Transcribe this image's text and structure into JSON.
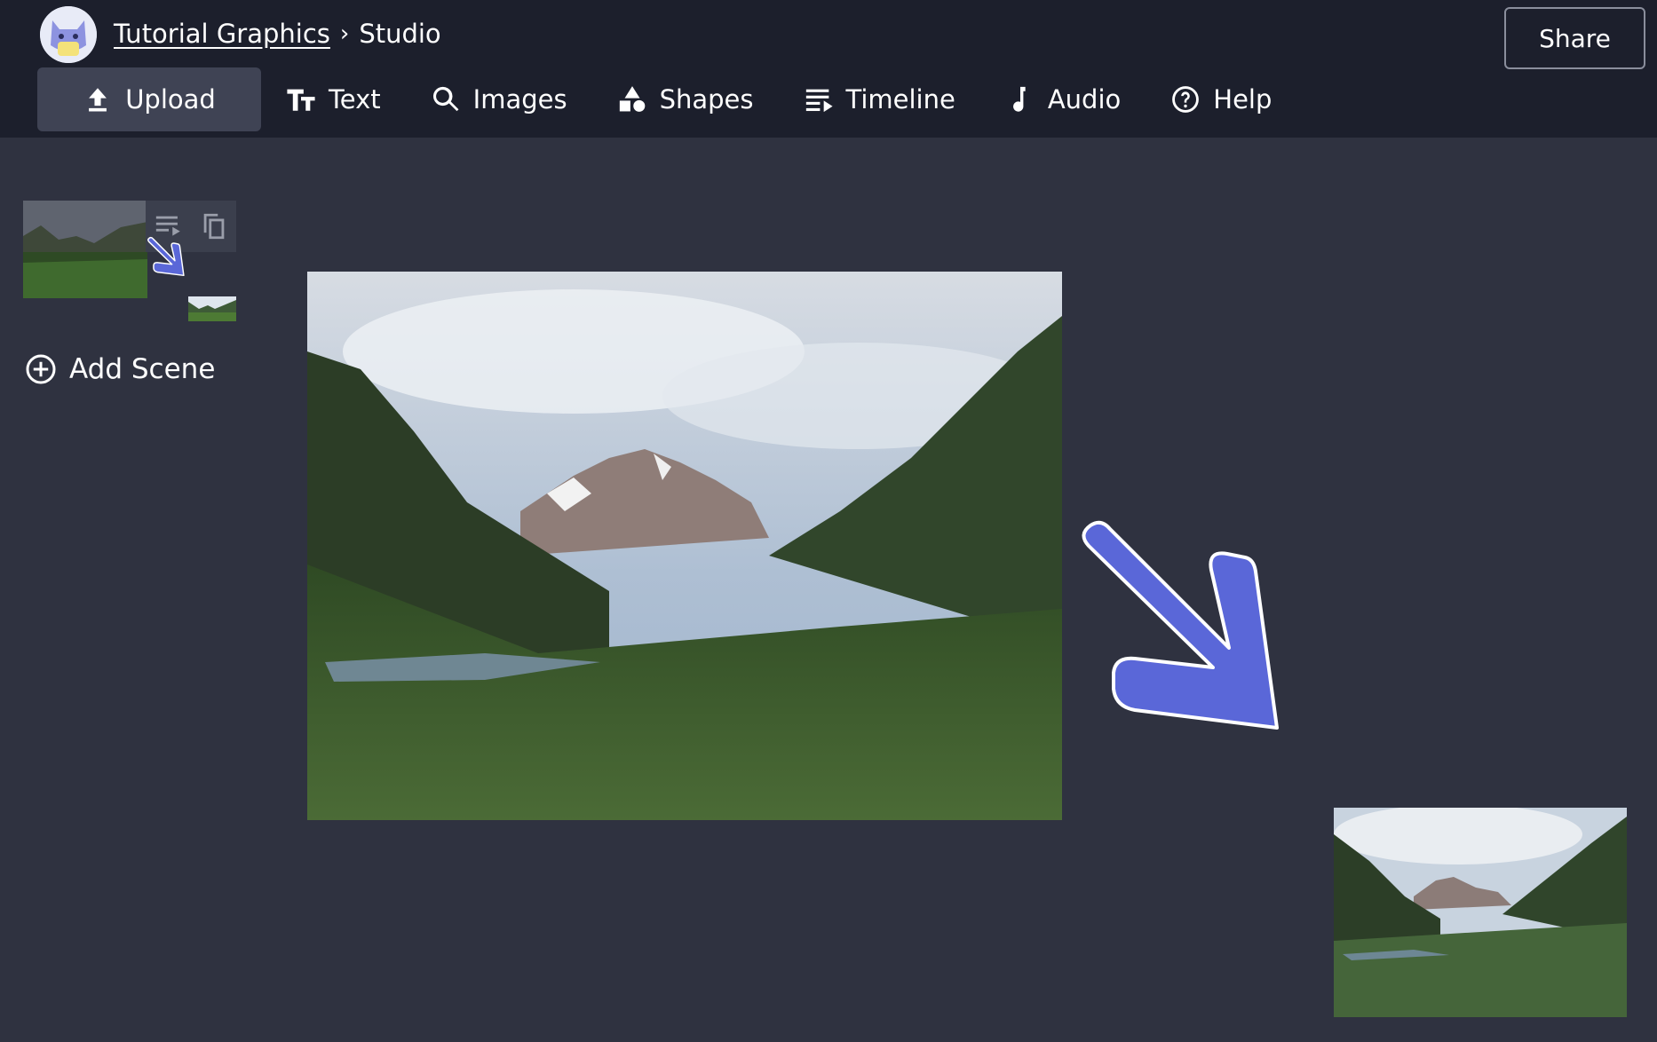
{
  "header": {
    "breadcrumb_project": "Tutorial Graphics",
    "breadcrumb_separator": "›",
    "breadcrumb_page": "Studio",
    "share_label": "Share"
  },
  "toolbar": {
    "items": [
      {
        "label": "Upload",
        "icon": "upload-icon",
        "active": true
      },
      {
        "label": "Text",
        "icon": "text-icon"
      },
      {
        "label": "Images",
        "icon": "search-icon"
      },
      {
        "label": "Shapes",
        "icon": "shapes-icon"
      },
      {
        "label": "Timeline",
        "icon": "timeline-icon"
      },
      {
        "label": "Audio",
        "icon": "music-note-icon"
      },
      {
        "label": "Help",
        "icon": "help-icon"
      }
    ]
  },
  "sidebar": {
    "add_scene_label": "Add Scene",
    "scene_action_icons": [
      "timeline-icon",
      "duplicate-icon"
    ]
  },
  "colors": {
    "header_bg": "#1c1f2c",
    "canvas_bg": "#2f3240",
    "arrow_fill": "#5a67d8",
    "active_tool_bg": "#3f4354"
  }
}
